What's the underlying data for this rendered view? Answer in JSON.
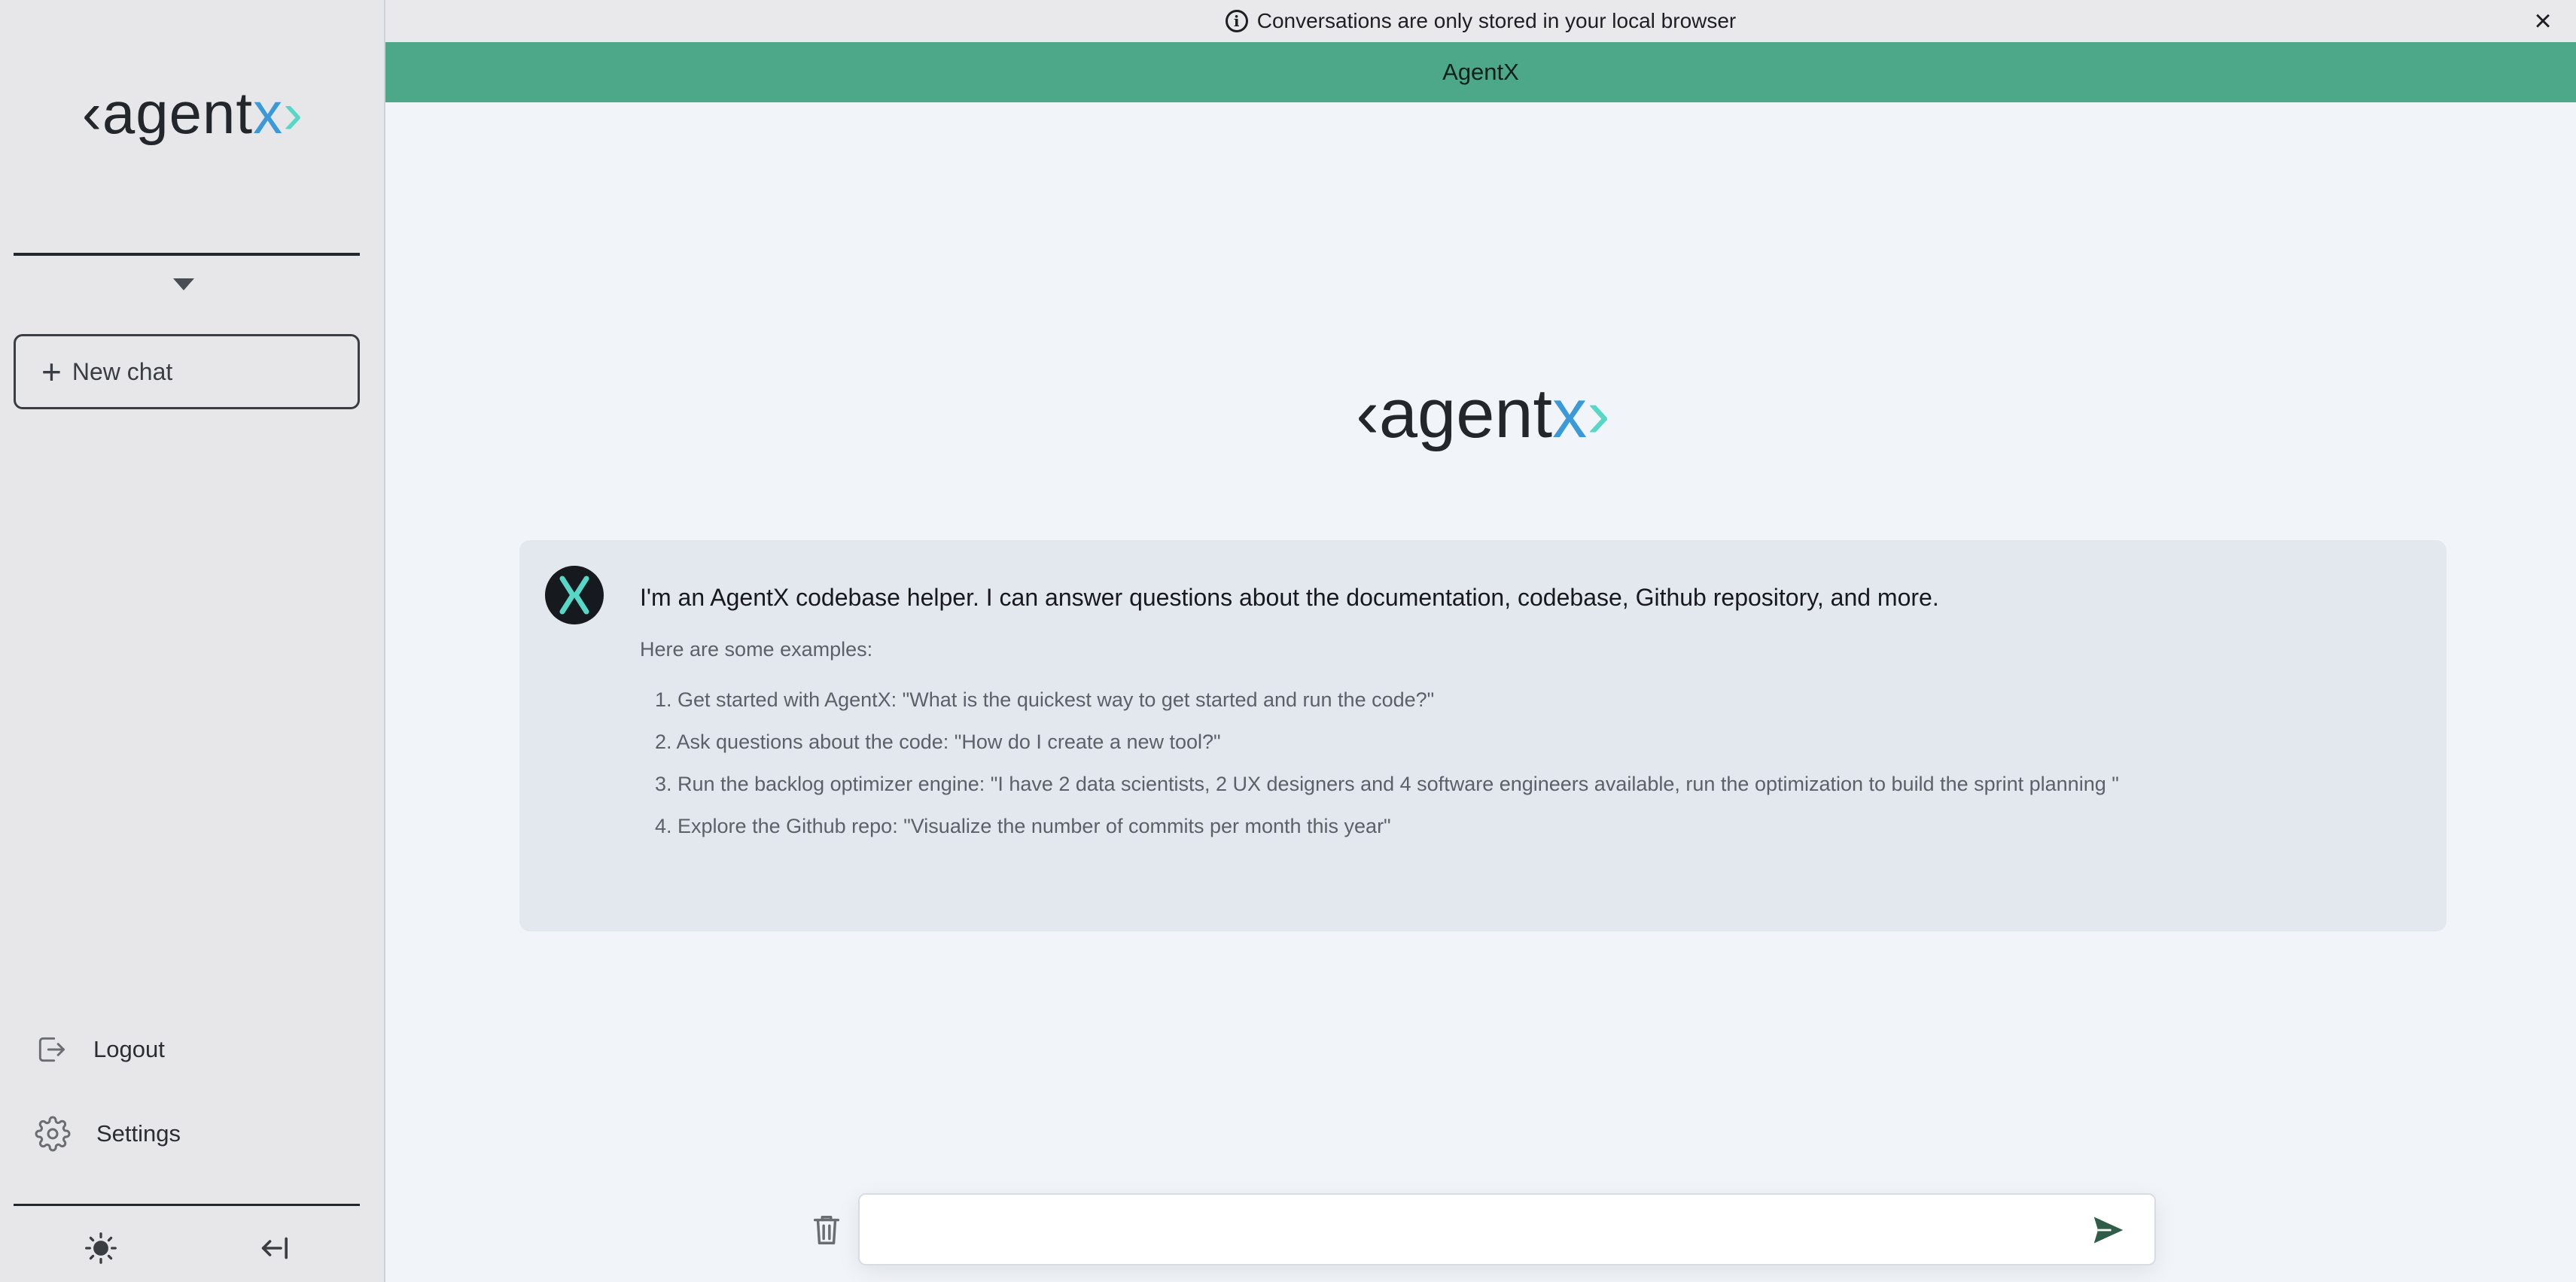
{
  "sidebar": {
    "logo": {
      "open": "‹agent",
      "x": "x",
      "close": "›"
    },
    "new_chat_label": "New chat",
    "logout_label": "Logout",
    "settings_label": "Settings"
  },
  "notice": {
    "text": "Conversations are only stored in your local browser",
    "close_icon": "×"
  },
  "header": {
    "title": "AgentX"
  },
  "main": {
    "logo": {
      "open": "‹agent",
      "x": "x",
      "close": "›"
    },
    "card": {
      "intro": "I'm an AgentX codebase helper. I can answer questions about the documentation, codebase, Github repository, and more.",
      "subtitle": "Here are some examples:",
      "examples": [
        "1. Get started with AgentX: \"What is the quickest way to get started and run the code?\"",
        "2. Ask questions about the code: \"How do I create a new tool?\"",
        "3. Run the backlog optimizer engine: \"I have 2 data scientists, 2 UX designers and 4 software engineers available, run the optimization to build the sprint planning \"",
        "4. Explore the Github repo: \"Visualize the number of commits per month this year\""
      ]
    }
  },
  "input": {
    "value": "",
    "placeholder": ""
  },
  "colors": {
    "accent_green": "#4da88a",
    "logo_x": "#3a9ad9",
    "logo_bracket": "#57d8c6"
  }
}
